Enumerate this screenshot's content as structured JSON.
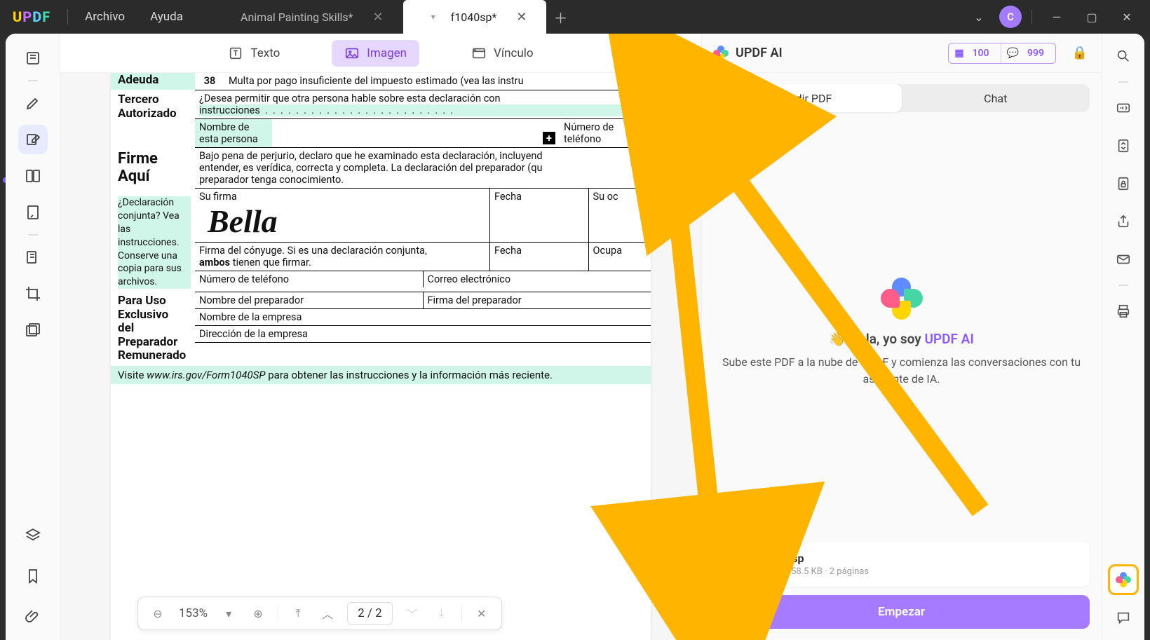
{
  "menu": {
    "archivo": "Archivo",
    "ayuda": "Ayuda"
  },
  "tabs": {
    "inactive": {
      "label": "Animal Painting Skills*"
    },
    "active": {
      "label": "f1040sp*"
    }
  },
  "avatar_letter": "C",
  "subbar": {
    "texto": "Texto",
    "imagen": "Imagen",
    "vinculo": "Vínculo"
  },
  "doc": {
    "adeuda": "Adeuda",
    "line38_num": "38",
    "line38": "Multa por pago insuficiente del impuesto estimado (vea las instru",
    "tercero_h1": "Tercero",
    "tercero_h2": "Autorizado",
    "tercero_q": "¿Desea permitir que otra persona hable sobre esta declaración con",
    "tercero_q2": "instrucciones",
    "nombre_persona": "Nombre de esta persona",
    "num_tel": "Número de teléfono",
    "firme_h1": "Firme",
    "firme_h2": "Aquí",
    "firme_p": "Bajo pena de perjurio, declaro que he examinado esta declaración, incluyend",
    "firme_p2": "entender, es verídica, correcta y completa. La declaración del preparador (qu",
    "firme_p3": "preparador tenga conocimiento.",
    "decl_q": "¿Declaración conjunta? Vea las instrucciones. Conserve una copia para sus archivos.",
    "su_firma": "Su firma",
    "fecha": "Fecha",
    "su_oc": "Su oc",
    "sig": "Bella",
    "firma_conyuge": "Firma del cónyuge. Si es una declaración conjunta,",
    "ambos": "ambos",
    "ambos_suffix": " tienen que firmar.",
    "ocupa": "Ocupa",
    "num_tel2": "Número de teléfono",
    "correo": "Correo electrónico",
    "prep_h1": "Para Uso",
    "prep_h2": "Exclusivo",
    "prep_h3": "del",
    "prep_h4": "Preparador",
    "prep_h5": "Remunerado",
    "nombre_prep": "Nombre del preparador",
    "firma_prep": "Firma del preparador",
    "nombre_emp": "Nombre de la empresa",
    "dir_emp": "Dirección de la empresa",
    "visite": "Visite ",
    "url": "www.irs.gov/Form1040SP",
    "url_suffix": " para obtener las instrucciones y la información más reciente."
  },
  "pager": {
    "zoom": "153%",
    "page_cur": "2",
    "page_sep": " / ",
    "page_tot": "2"
  },
  "ai": {
    "title": "UPDF AI",
    "badge1": "100",
    "badge2": "999",
    "tab_pedir": "Pedir PDF",
    "tab_chat": "Chat",
    "hello_pre": "👋 Hola, yo soy ",
    "hello_brand": "UPDF AI",
    "msg": "Sube este PDF a la nube de UPDF y comienza las conversaciones con tu asistente de IA.",
    "file_name": "f1040sp",
    "file_detail": "PDF · 158.5 KB · 2 páginas",
    "start": "Empezar"
  }
}
